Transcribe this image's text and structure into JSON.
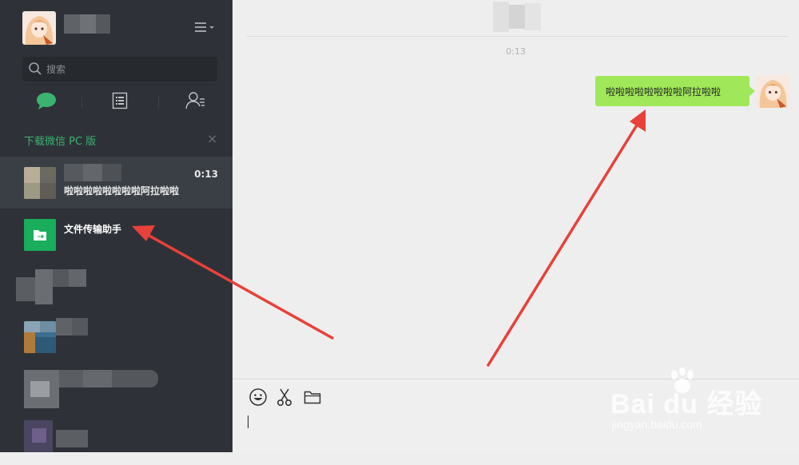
{
  "sidebar": {
    "search": {
      "placeholder": "搜索"
    },
    "download_banner": {
      "text": "下载微信 PC 版",
      "close": "×"
    },
    "chats": [
      {
        "name": "",
        "time": "0:13",
        "preview": "啦啦啦啦啦啦啦啦阿拉啦啦"
      },
      {
        "name": "文件传输助手",
        "time": "",
        "preview": ""
      }
    ]
  },
  "conversation": {
    "timestamp": "0:13",
    "messages": [
      {
        "sender": "self",
        "text": "啦啦啦啦啦啦啦啦阿拉啦啦"
      }
    ]
  },
  "toolbar": {
    "icons": [
      "emoji-icon",
      "scissors-icon",
      "folder-icon"
    ]
  },
  "watermark": {
    "main": "Bai du 经验",
    "sub": "jingyan.baidu.com"
  },
  "colors": {
    "sidebar_bg": "#2e3238",
    "accent_green": "#3cb371",
    "bubble_green": "#a0e75a",
    "arrow_red": "#e8413a"
  }
}
